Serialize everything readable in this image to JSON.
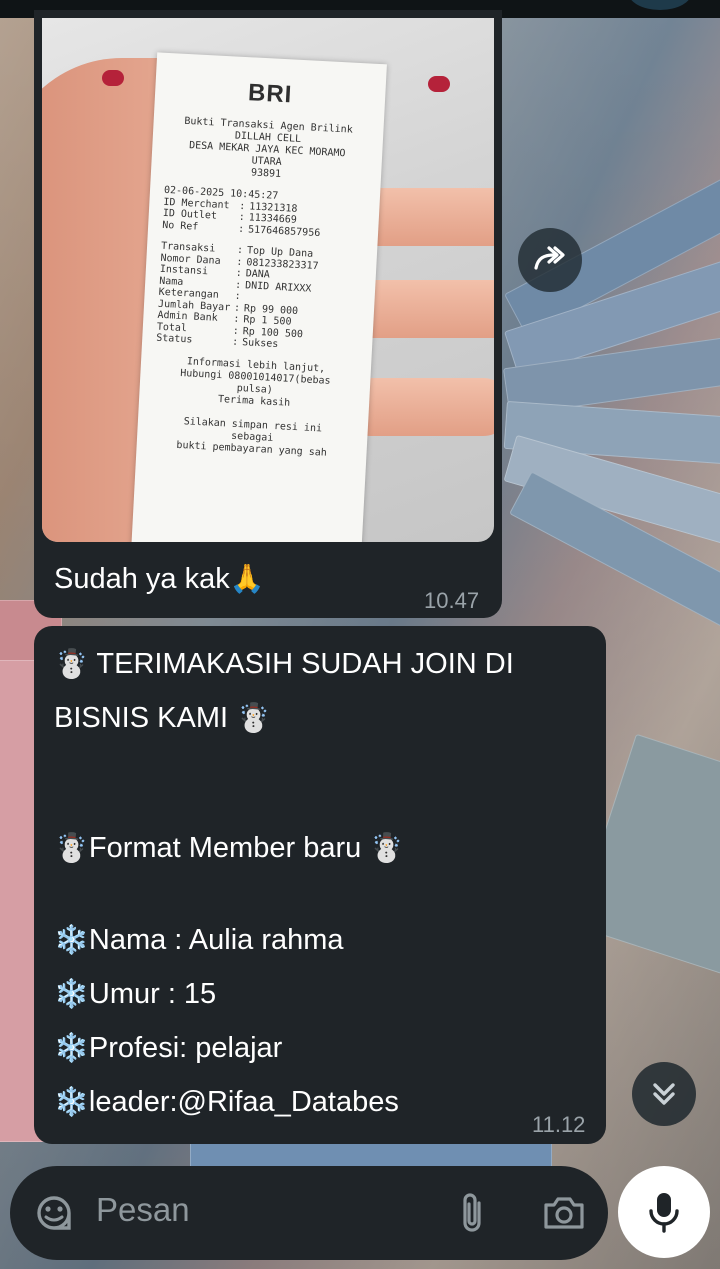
{
  "receipt": {
    "logo_text": "BRI",
    "header_lines": [
      "Bukti Transaksi Agen Brilink",
      "DILLAH CELL",
      "DESA MEKAR JAYA KEC MORAMO",
      "UTARA",
      "93891"
    ],
    "rows_a": [
      {
        "k": "02-06-2025 10:45:27",
        "v": ""
      },
      {
        "k": "ID Merchant",
        "v": "11321318"
      },
      {
        "k": "ID Outlet",
        "v": "11334669"
      },
      {
        "k": "No Ref",
        "v": "517646857956"
      }
    ],
    "rows_b": [
      {
        "k": "Transaksi",
        "v": "Top Up Dana"
      },
      {
        "k": "Nomor Dana",
        "v": "081233823317"
      },
      {
        "k": "Instansi",
        "v": "DANA"
      },
      {
        "k": "Nama",
        "v": "DNID ARIXXX"
      },
      {
        "k": "Keterangan",
        "v": ""
      },
      {
        "k": "Jumlah Bayar",
        "v": "Rp 99 000"
      },
      {
        "k": "Admin Bank",
        "v": "Rp 1 500"
      },
      {
        "k": "Total",
        "v": "Rp 100 500"
      },
      {
        "k": "Status",
        "v": "Sukses"
      }
    ],
    "footer_lines": [
      "Informasi lebih lanjut,",
      "Hubungi 08001014017(bebas",
      "pulsa)",
      "Terima kasih",
      "",
      "Silakan simpan resi ini",
      "sebagai",
      "bukti pembayaran yang sah"
    ]
  },
  "messages": {
    "photo_caption": "Sudah ya kak",
    "photo_caption_emoji": "🙏",
    "photo_time": "10.47",
    "text_time": "11.12",
    "lines": {
      "l1_emoji": "☃️",
      "l1": "TERIMAKASIH SUDAH JOIN DI",
      "l2": "BISNIS KAMI",
      "l2_emoji": "☃️",
      "l3_emoji_a": "☃️",
      "l3": "Format Member baru",
      "l3_emoji_b": "☃️",
      "snow": "❄️",
      "l4": "Nama : Aulia rahma",
      "l5": "Umur : 15",
      "l6": "Profesi: pelajar",
      "l7": "leader:@Rifaa_Databes"
    }
  },
  "composer": {
    "placeholder": "Pesan"
  },
  "icons": {
    "forward": "forward-icon",
    "scroll_down": "chevron-double-down-icon",
    "emoji": "sticker-icon",
    "attach": "paperclip-icon",
    "camera": "camera-icon",
    "mic": "mic-icon"
  }
}
